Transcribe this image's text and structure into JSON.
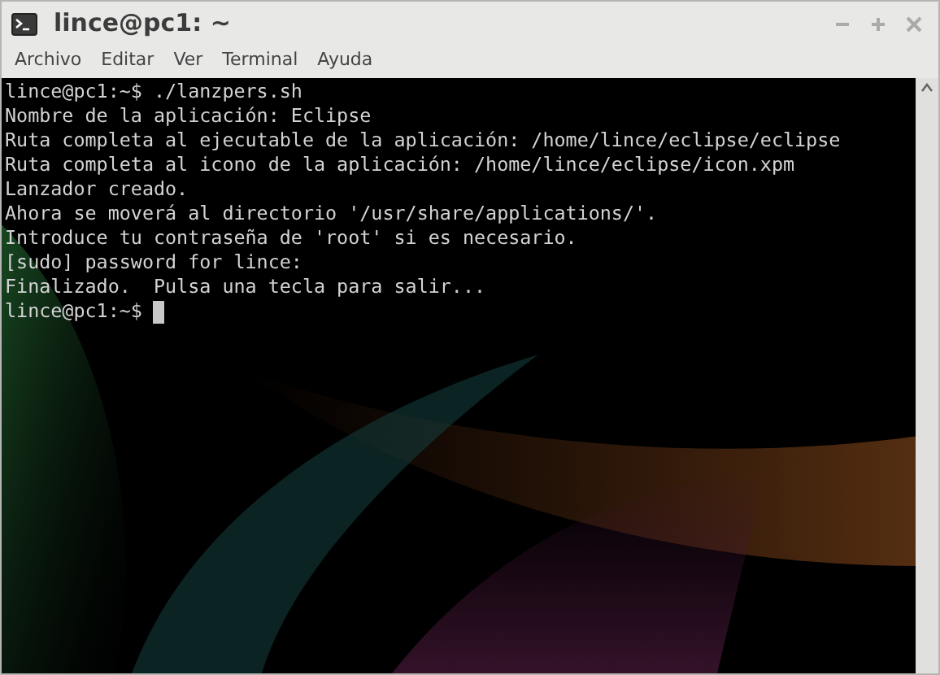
{
  "window": {
    "title": "lince@pc1: ~"
  },
  "menu": [
    "Archivo",
    "Editar",
    "Ver",
    "Terminal",
    "Ayuda"
  ],
  "terminal": {
    "lines": [
      "lince@pc1:~$ ./lanzpers.sh",
      "Nombre de la aplicación: Eclipse",
      "Ruta completa al ejecutable de la aplicación: /home/lince/eclipse/eclipse",
      "Ruta completa al icono de la aplicación: /home/lince/eclipse/icon.xpm",
      "Lanzador creado.",
      "Ahora se moverá al directorio '/usr/share/applications/'.",
      "Introduce tu contraseña de 'root' si es necesario.",
      "[sudo] password for lince:",
      "Finalizado.  Pulsa una tecla para salir..."
    ],
    "prompt": "lince@pc1:~$ "
  }
}
